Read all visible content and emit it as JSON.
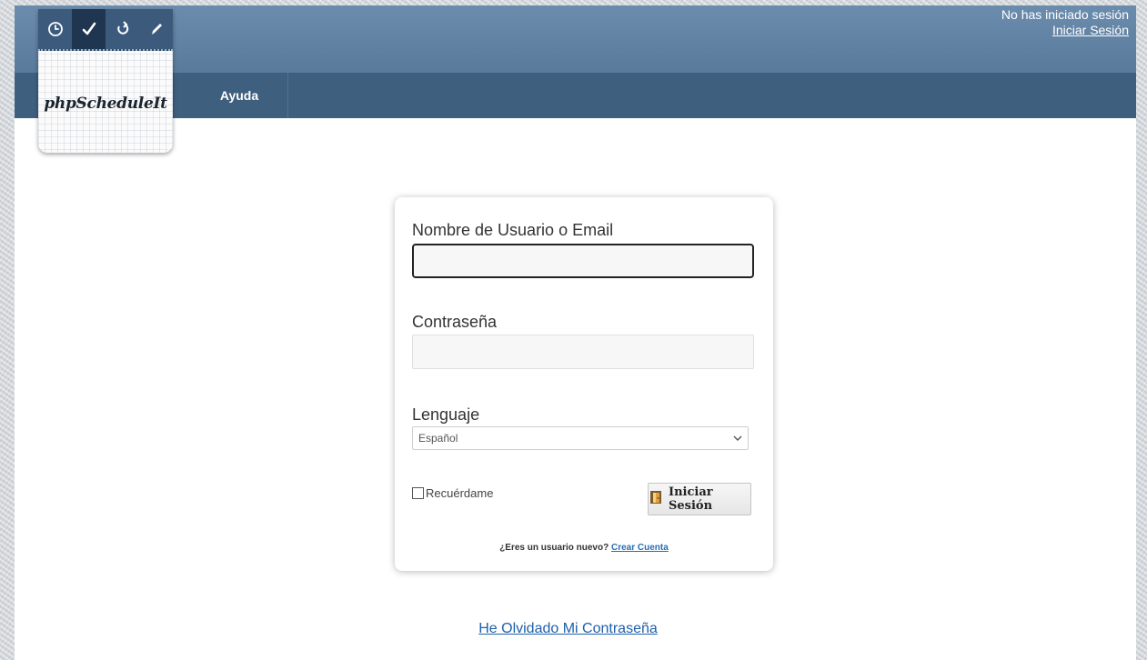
{
  "header": {
    "nav_items": [
      {
        "label": "Ayuda"
      }
    ],
    "session_status": "No has iniciado sesión",
    "session_link": "Iniciar Sesión"
  },
  "logo": {
    "title": "phpScheduleIt",
    "icons": [
      "clock-icon",
      "check-icon",
      "refresh-icon",
      "pencil-icon"
    ]
  },
  "login_form": {
    "username_label": "Nombre de Usuario o Email",
    "username_value": "",
    "password_label": "Contraseña",
    "password_value": "",
    "language_label": "Lenguaje",
    "language_selected": "Español",
    "remember_label": "Recuérdame",
    "remember_checked": false,
    "submit_label": "Iniciar Sesión",
    "new_user_prompt": "¿Eres un usuario nuevo?",
    "create_account_link": "Crear Cuenta"
  },
  "footer": {
    "forgot_password_link": "He Olvidado Mi Contraseña"
  },
  "colors": {
    "header_top": "#5f7fa0",
    "header_nav": "#3f5f7f",
    "link": "#2a6db5"
  }
}
